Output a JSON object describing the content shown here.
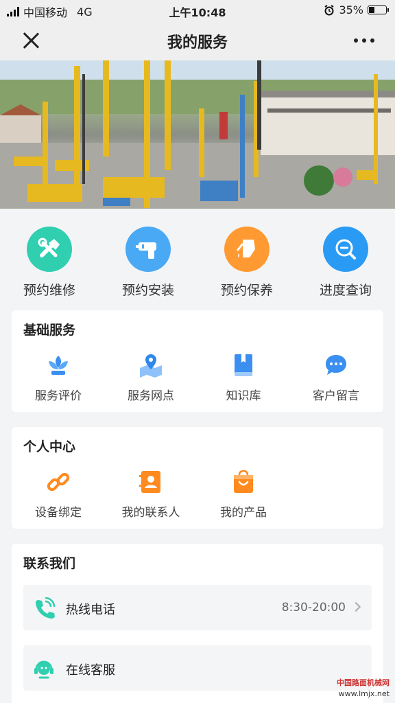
{
  "status_bar": {
    "carrier": "中国移动",
    "network": "4G",
    "time": "上午10:48",
    "battery_percent": "35%",
    "battery_level": 0.35
  },
  "nav": {
    "title": "我的服务",
    "close_icon": "close-icon",
    "more_icon": "more-icon"
  },
  "quick_actions": [
    {
      "label": "预约维修",
      "icon": "repair-tools-icon",
      "color": "#2fcfb0"
    },
    {
      "label": "预约安装",
      "icon": "drill-icon",
      "color": "#4aa9f5"
    },
    {
      "label": "预约保养",
      "icon": "oil-can-icon",
      "color": "#ff9a33"
    },
    {
      "label": "进度查询",
      "icon": "progress-search-icon",
      "color": "#2a9bf5"
    }
  ],
  "basic_services": {
    "title": "基础服务",
    "items": [
      {
        "label": "服务评价",
        "icon": "flower-icon"
      },
      {
        "label": "服务网点",
        "icon": "map-pin-icon"
      },
      {
        "label": "知识库",
        "icon": "book-icon"
      },
      {
        "label": "客户留言",
        "icon": "chat-bubble-icon"
      }
    ]
  },
  "personal_center": {
    "title": "个人中心",
    "items": [
      {
        "label": "设备绑定",
        "icon": "link-icon"
      },
      {
        "label": "我的联系人",
        "icon": "contact-book-icon"
      },
      {
        "label": "我的产品",
        "icon": "shopping-bag-icon"
      }
    ]
  },
  "contact_us": {
    "title": "联系我们",
    "rows": [
      {
        "label": "热线电话",
        "value": "8:30-20:00",
        "icon": "phone-icon"
      },
      {
        "label": "在线客服",
        "value": "",
        "icon": "headset-icon"
      }
    ]
  },
  "watermark": {
    "line1": "中国路面机械网",
    "line2": "www.lmjx.net"
  },
  "colors": {
    "accent_teal": "#2fcfb0",
    "accent_blue": "#2a9bf5",
    "accent_orange": "#ff8a1f"
  }
}
